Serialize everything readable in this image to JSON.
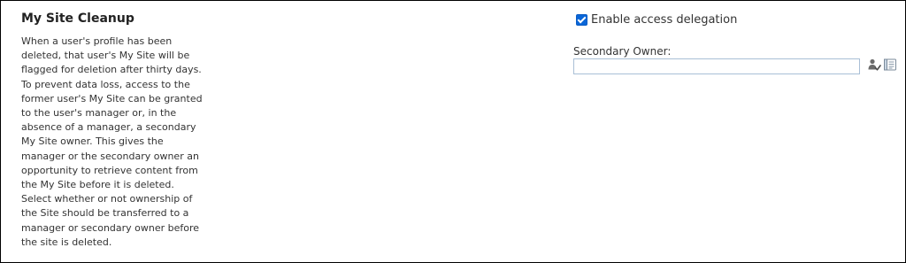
{
  "section": {
    "title": "My Site Cleanup",
    "description": "When a user's profile has been deleted, that user's My Site will be flagged for deletion after thirty days. To prevent data loss, access to the former user's My Site can be granted to the user's manager or, in the absence of a manager, a secondary My Site owner. This gives the manager or the secondary owner an opportunity to retrieve content from the My Site before it is deleted. Select whether or not ownership of the Site should be transferred to a manager or secondary owner before the site is deleted."
  },
  "delegation": {
    "label": "Enable access delegation",
    "checked": true
  },
  "secondary_owner": {
    "label": "Secondary Owner:",
    "value": ""
  },
  "icons": {
    "check_names": "check-names-icon",
    "browse": "address-book-icon"
  },
  "colors": {
    "checkbox_accent": "#0a66d8",
    "input_border": "#a9bfd6"
  }
}
